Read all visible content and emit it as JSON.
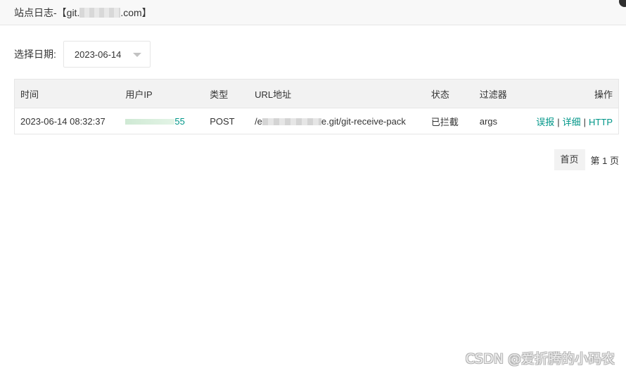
{
  "dialog": {
    "title_prefix": "站点日志-【git.",
    "title_suffix": ".com】"
  },
  "filter": {
    "date_label": "选择日期:",
    "date_value": "2023-06-14"
  },
  "table": {
    "headers": {
      "time": "时间",
      "ip": "用户IP",
      "type": "类型",
      "url": "URL地址",
      "status": "状态",
      "filter": "过滤器",
      "actions": "操作"
    },
    "rows": [
      {
        "time": "2023-06-14 08:32:37",
        "ip_tail": "55",
        "type": "POST",
        "url_prefix": "/e",
        "url_suffix": "e.git/git-receive-pack",
        "status": "已拦截",
        "filter": "args",
        "actions": {
          "misreport": "误报",
          "sep": "|",
          "detail": "详细",
          "http": "HTTP"
        }
      }
    ]
  },
  "pager": {
    "first": "首页",
    "current": "第 1 页"
  },
  "watermark": "CSDN @爱折腾的小码农",
  "colors": {
    "accent": "#009688",
    "header_bg": "#f8f8f8",
    "table_head_bg": "#f2f2f2",
    "border": "#e6e6e6"
  }
}
